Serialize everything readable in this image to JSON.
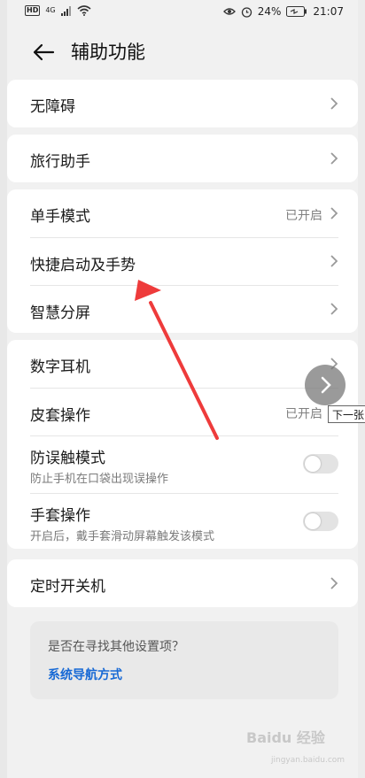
{
  "status_bar": {
    "hd": "HD",
    "signal": "4G",
    "battery_percent": "24%",
    "time": "21:07"
  },
  "header": {
    "title": "辅助功能"
  },
  "settings": {
    "accessibility": "无障碍",
    "travel_assistant": "旅行助手",
    "one_hand_mode": "单手模式",
    "one_hand_mode_value": "已开启",
    "shortcuts_gestures": "快捷启动及手势",
    "smart_split_screen": "智慧分屏",
    "digital_earphone": "数字耳机",
    "cover_operation": "皮套操作",
    "cover_operation_value": "已开启",
    "accidental_touch": "防误触模式",
    "accidental_touch_sub": "防止手机在口袋出现误操作",
    "glove_mode": "手套操作",
    "glove_mode_sub": "开启后，戴手套滑动屏幕触发该模式",
    "scheduled_power": "定时开关机"
  },
  "tip": {
    "question": "是否在寻找其他设置项？",
    "link": "系统导航方式"
  },
  "overlay": {
    "tooltip": "下一张"
  },
  "watermark": {
    "text": "Baidu 经验",
    "url": "jingyan.baidu.com"
  },
  "colors": {
    "accent_link": "#1769d5",
    "annotation_arrow": "#ee3b3b"
  }
}
